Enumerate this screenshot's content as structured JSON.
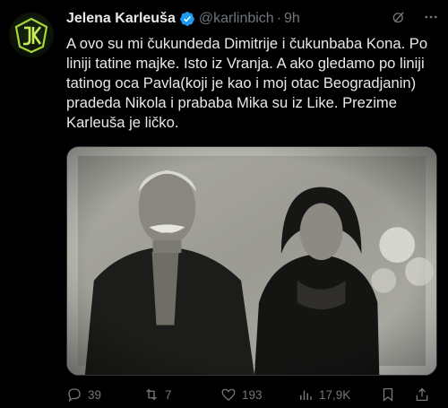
{
  "author": {
    "name": "Jelena Karleuša",
    "handle": "@karlinbich",
    "separator": "·",
    "time": "9h",
    "avatar_icon": "jk-monogram-logo",
    "verified_icon": "verified-badge-icon"
  },
  "tweet": {
    "text": "A ovo su mi čukundeda Dimitrije i čukunbaba Kona. Po liniji tatine majke. Isto iz Vranja. A ako gledamo po liniji tatinog oca Pavla(koji je kao i moj otac Beogradjanin) pradeda Nikola i prababa Mika su iz Like. Prezime Karleuša je ličko."
  },
  "photo": {
    "subject": "sepia-portrait-elderly-couple"
  },
  "actions": {
    "replies": "39",
    "retweets": "7",
    "likes": "193",
    "views": "17,9K"
  },
  "colors": {
    "background": "#000000",
    "text": "#e7e9ea",
    "muted": "#71767b",
    "verified": "#1d9bf0",
    "avatar_accent": "#9acd32"
  }
}
